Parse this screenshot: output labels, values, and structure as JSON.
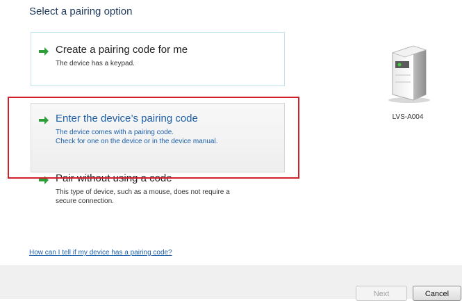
{
  "heading": "Select a pairing option",
  "options": [
    {
      "title": "Create a pairing code for me",
      "desc_lines": [
        "The device has a keypad."
      ]
    },
    {
      "title": "Enter the device’s pairing code",
      "desc_lines": [
        "The device comes with a pairing code.",
        "Check for one on the device or in the device manual."
      ]
    },
    {
      "title": "Pair without using a code",
      "desc_lines": [
        "This type of device, such as a mouse, does not require a",
        "secure connection."
      ]
    }
  ],
  "device": {
    "label": "LVS-A004",
    "icon": "printer-device-icon"
  },
  "help_link": "How can I tell if my device has a pairing code?",
  "buttons": {
    "next": "Next",
    "cancel": "Cancel"
  },
  "colors": {
    "link_blue": "#1d5fa8",
    "arrow_green": "#2e9e3a",
    "highlight_red": "#d11f2a"
  }
}
